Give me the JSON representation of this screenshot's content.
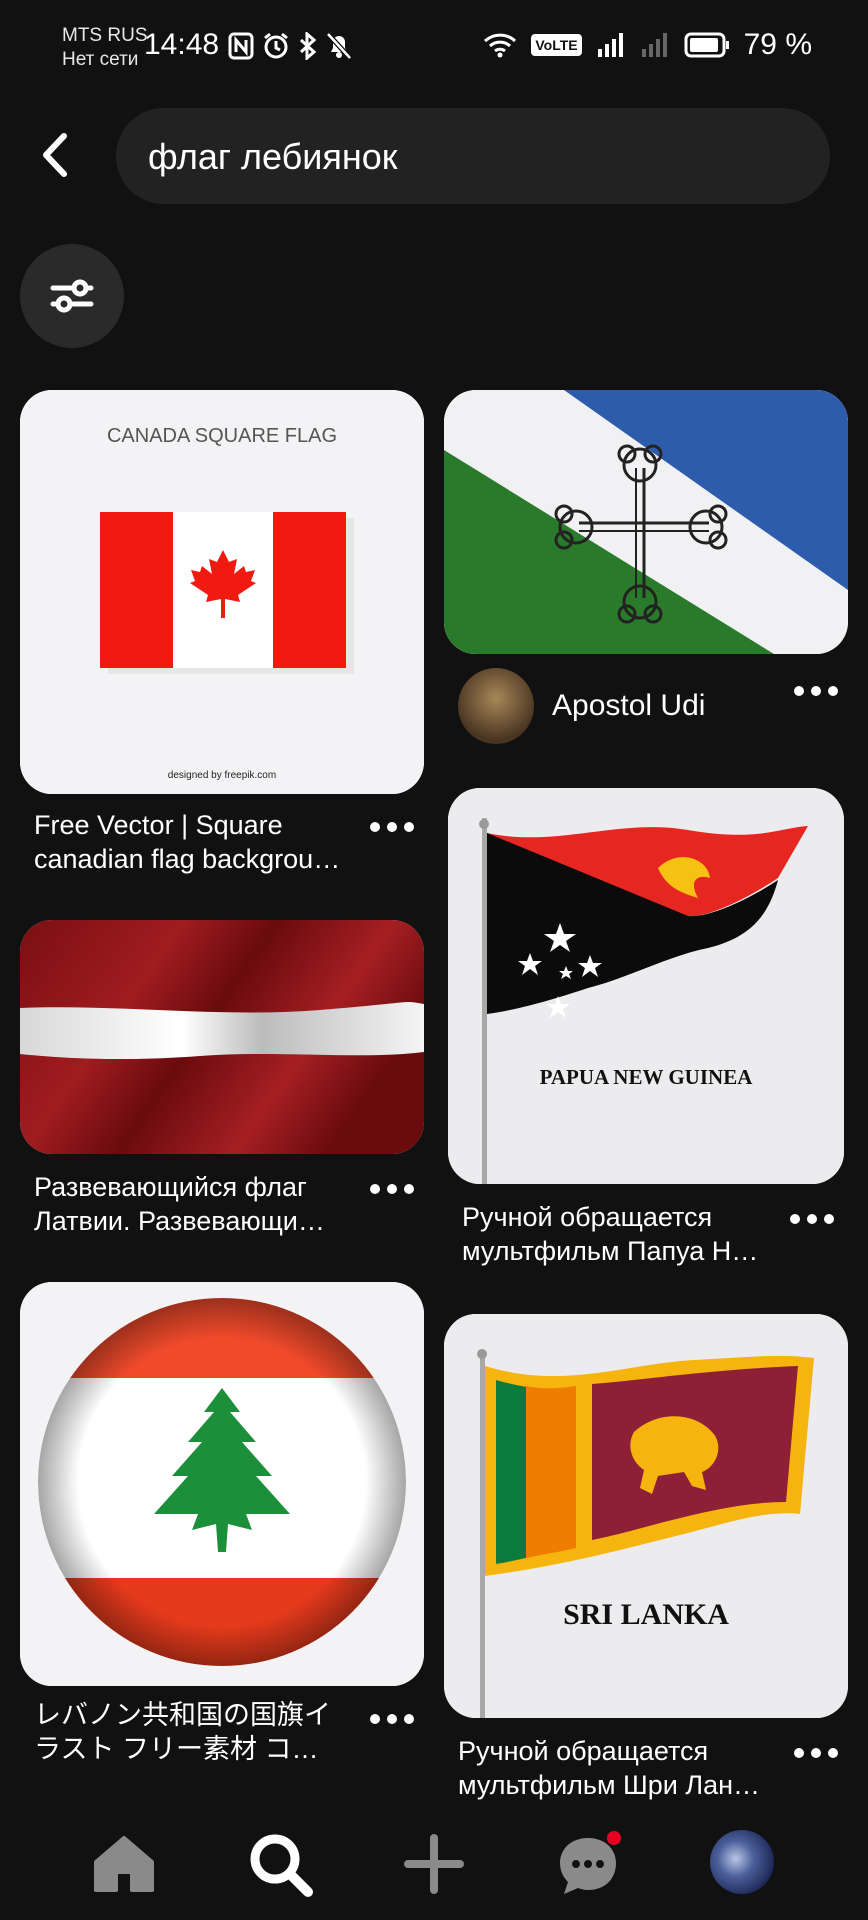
{
  "status_bar": {
    "carrier": "MTS RUS",
    "network": "Нет сети",
    "time": "14:48",
    "battery": "79 %",
    "volte": "VoLTE"
  },
  "search": {
    "query": "флаг лебиянок"
  },
  "pins": [
    {
      "image_heading": "CANADA SQUARE FLAG",
      "image_credit": "designed by freepik.com",
      "title_line1": "Free Vector | Square",
      "title_line2": "canadian flag backgrou…"
    },
    {
      "author": "Apostol Udi"
    },
    {
      "title_line1": "Развевающийся флаг",
      "title_line2": "Латвии. Развевающи…"
    },
    {
      "image_heading": "PAPUA NEW GUINEA",
      "title_line1": "Ручной обращается",
      "title_line2": "мультфильм Папуа Н…"
    },
    {
      "title_line1": "レバノン共和国の国旗イ",
      "title_line2": "ラスト フリー素材 コ…"
    },
    {
      "image_heading": "SRI LANKA",
      "title_line1": "Ручной обращается",
      "title_line2": "мультфильм Шри Лан…"
    }
  ],
  "nav": {
    "items": [
      "home-icon",
      "search-icon",
      "plus-icon",
      "messages-icon",
      "profile-avatar"
    ],
    "notification_color": "#e60023"
  }
}
